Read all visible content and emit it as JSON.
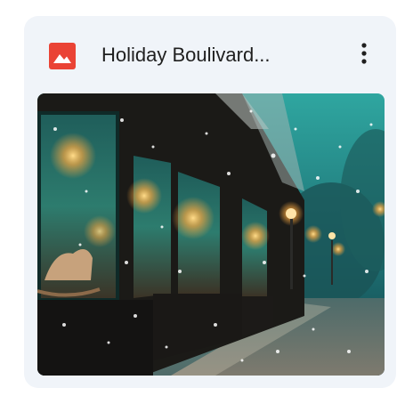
{
  "card": {
    "file_type_icon": "image-file-icon",
    "title": "Holiday Boulivard...",
    "more_icon": "more-vert-icon",
    "thumbnail_subject": "snowy-christmas-storefront-street-image"
  },
  "colors": {
    "card_background": "#f0f4f9",
    "title_text": "#1f1f1f",
    "file_icon": "#ea4335",
    "more_icon": "#1f1f1f"
  }
}
